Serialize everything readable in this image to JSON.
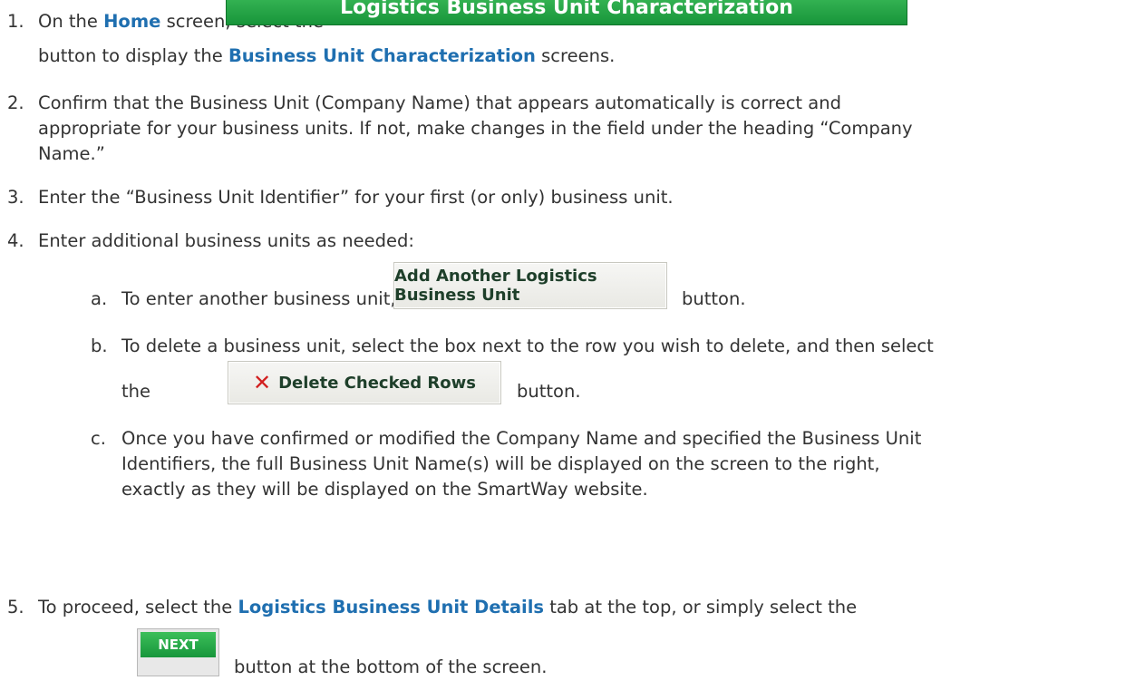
{
  "buttons": {
    "logistics_bu_char": "Logistics Business Unit Characterization",
    "add_bu": "Add Another Logistics Business Unit",
    "delete_rows": "Delete Checked Rows",
    "next": "NEXT"
  },
  "icons": {
    "delete": "x-icon"
  },
  "colors": {
    "highlight": "#1f6fb0",
    "green_button": "#18953a",
    "delete_x": "#d21f1f"
  },
  "step1": {
    "num": "1.",
    "t1": "On the ",
    "home": "Home",
    "t2": " screen, select the",
    "t3": "button to display the ",
    "bu_char": "Business Unit Characterization",
    "t4": " screens."
  },
  "step2": {
    "num": "2.",
    "l1": "Confirm that the Business Unit (Company Name) that appears automatically is correct and",
    "l2": "appropriate for your business units.  If not, make changes in the field under the heading “Company",
    "l3": "Name.”"
  },
  "step3": {
    "num": "3.",
    "l1": "Enter the “Business Unit Identifier” for your first (or only) business unit."
  },
  "step4": {
    "num": "4.",
    "l1": "Enter additional business units as needed:",
    "a_letter": "a.",
    "a_text": "To enter another business unit, select the",
    "a_after": "button.",
    "b_letter": "b.",
    "b_l1": "To delete a business unit, select the box next to the row you wish to delete, and then select",
    "b_l2": "the",
    "b_after": "button.",
    "c_letter": "c.",
    "c_l1": "Once you have confirmed or modified the Company Name and specified the Business Unit",
    "c_l2": "Identifiers, the full Business Unit Name(s) will be displayed on the screen to the right,",
    "c_l3": "exactly as they will be displayed on the SmartWay website."
  },
  "step5": {
    "num": "5.",
    "t1": "To proceed, select the ",
    "details": "Logistics Business Unit Details",
    "t2": " tab at the top, or simply select the",
    "l2": "button at the bottom of the screen."
  }
}
